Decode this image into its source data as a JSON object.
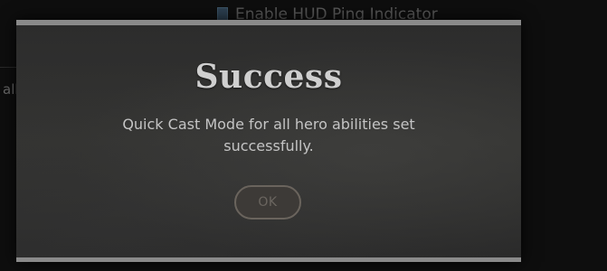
{
  "background": {
    "hud_option_label": "Enable HUD Ping Indicator",
    "side_text": "all"
  },
  "dialog": {
    "title": "Success",
    "message": "Quick Cast Mode for all hero abilities set successfully.",
    "ok_label": "OK"
  },
  "colors": {
    "dialog_bg": "#2f2f2e",
    "title_text": "#cfcfcf",
    "body_text": "#c4c4c4",
    "button_border": "#6a645d",
    "edge": "#8a8a8a"
  }
}
